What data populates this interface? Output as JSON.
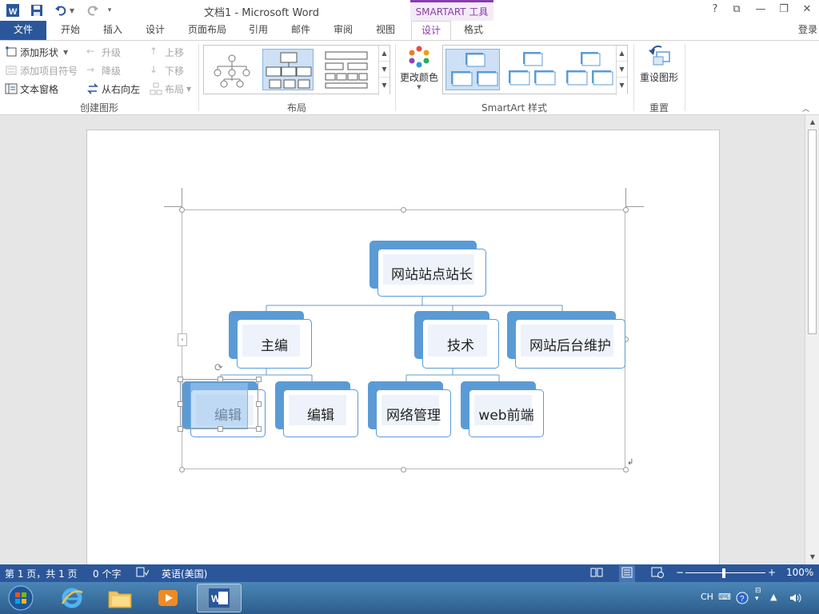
{
  "titlebar": {
    "doc_title": "文档1 - Microsoft Word",
    "contextual_tab": "SMARTART 工具",
    "help": "?",
    "restore_ribbon": "⧉",
    "minimize": "—",
    "maximize": "❐",
    "close": "✕"
  },
  "tabs": {
    "file": "文件",
    "items": [
      "开始",
      "插入",
      "设计",
      "页面布局",
      "引用",
      "邮件",
      "审阅",
      "视图"
    ],
    "design": "设计",
    "format": "格式",
    "login": "登录"
  },
  "ribbon": {
    "create_group": {
      "label": "创建图形",
      "add_shape": "添加形状",
      "add_bullet": "添加项目符号",
      "text_pane": "文本窗格",
      "promote": "升级",
      "demote": "降级",
      "right_to_left": "从右向左",
      "move_up": "上移",
      "move_down": "下移",
      "layout": "布局"
    },
    "layout_group": {
      "label": "布局"
    },
    "styles_group": {
      "label": "SmartArt 样式",
      "change_colors": "更改颜色"
    },
    "reset_group": {
      "label": "重置",
      "reset_graphic": "重设图形"
    },
    "colors": {
      "accent": "#5b9bd5",
      "word_blue": "#2b579a",
      "tools_purple": "#8a3cad"
    }
  },
  "smartart": {
    "root": "网站站点站长",
    "level2": [
      "主编",
      "技术",
      "网站后台维护"
    ],
    "level3": [
      "编辑",
      "编辑",
      "网络管理",
      "web前端"
    ]
  },
  "statusbar": {
    "page": "第 1 页，共 1 页",
    "words": "0 个字",
    "language": "英语(美国)",
    "zoom": "100%"
  },
  "taskbar": {
    "ime": "CH"
  }
}
